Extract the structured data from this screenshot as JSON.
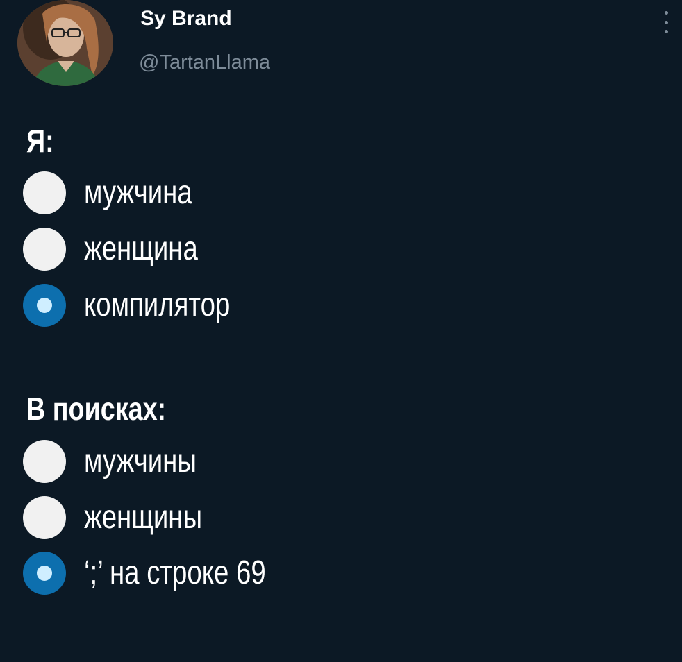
{
  "header": {
    "display_name": "Sy Brand",
    "handle": "@TartanLlama",
    "avatar_icon": "profile-photo",
    "menu_icon": "more-vertical-icon"
  },
  "tweet": {
    "sections": [
      {
        "heading": "Я:",
        "options": [
          {
            "label": "мужчина",
            "selected": false
          },
          {
            "label": "женщина",
            "selected": false
          },
          {
            "label": "компилятор",
            "selected": true
          }
        ]
      },
      {
        "heading": "В поисках:",
        "options": [
          {
            "label": "мужчины",
            "selected": false
          },
          {
            "label": "женщины",
            "selected": false
          },
          {
            "label": "‘;’ на строке 69",
            "selected": true
          }
        ]
      }
    ]
  },
  "colors": {
    "background": "#0c1925",
    "text": "#ffffff",
    "muted": "#7e8c99",
    "radio_selected": "#0d6fae",
    "radio_dot": "#cfeeff",
    "radio_unselected": "#f1f1f1"
  }
}
